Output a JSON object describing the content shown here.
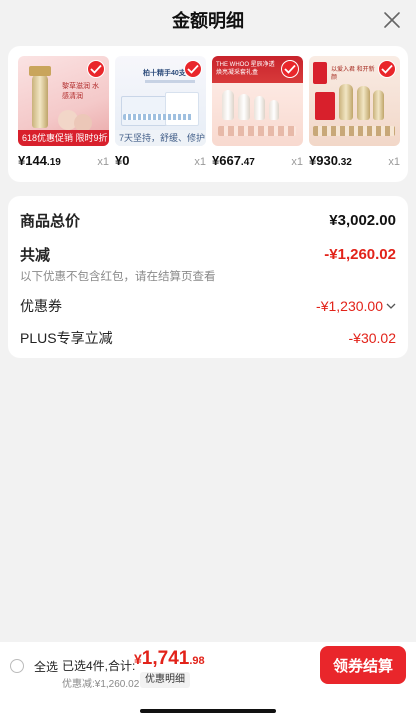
{
  "header": {
    "title": "金额明细"
  },
  "products": [
    {
      "price_int": "¥144",
      "price_dec": ".19",
      "qty": "x1",
      "banner": "618优惠促销 限时9折",
      "thumb_text": "黎草滋润 水感清润"
    },
    {
      "price_int": "¥0",
      "price_dec": "",
      "qty": "x1",
      "banner": "7天坚持，舒缓、修护",
      "thumb_text": "柏十精手40支"
    },
    {
      "price_int": "¥667",
      "price_dec": ".47",
      "qty": "x1",
      "banner": "",
      "thumb_text": "THE WHOO 星辰净透 焕亮凝采套礼盒"
    },
    {
      "price_int": "¥930",
      "price_dec": ".32",
      "qty": "x1",
      "banner": "",
      "thumb_text": "以爱入君 和开新颜"
    }
  ],
  "summary": {
    "total_label": "商品总价",
    "total_value": "¥3,002.00",
    "reduce_label": "共减",
    "reduce_value": "-¥1,260.02",
    "reduce_note": "以下优惠不包含红包，请在结算页查看",
    "coupon_label": "优惠券",
    "coupon_value": "-¥1,230.00",
    "plus_label": "PLUS专享立减",
    "plus_value": "-¥30.02"
  },
  "footer": {
    "select_all": "全选",
    "selected": "已选4件,合计:",
    "total_cur": "¥",
    "total_int": "1,741",
    "total_dec": ".98",
    "discount": "优惠减:¥1,260.02",
    "detail_tag": "优惠明细",
    "pay_button": "领券结算"
  },
  "colors": {
    "accent": "#e9262b",
    "price_red": "#e2231a"
  }
}
